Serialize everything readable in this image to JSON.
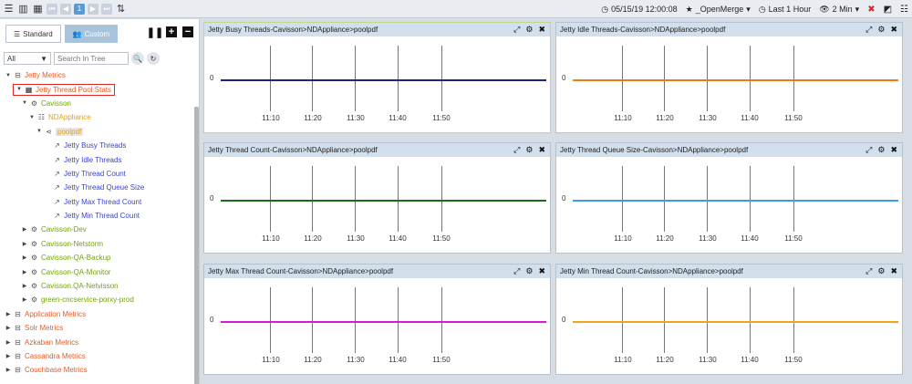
{
  "toolbar": {
    "timestamp": "05/15/19 12:00:08",
    "favorite": "_OpenMerge",
    "time_range": "Last 1 Hour",
    "refresh": "2 Min",
    "page_num": "1"
  },
  "sidebar": {
    "tabs": [
      {
        "label": "Standard"
      },
      {
        "label": "Custom"
      }
    ],
    "filter_value": "All",
    "search_placeholder": "Search In Tree",
    "tree": [
      {
        "label": "Jetty Metrics"
      },
      {
        "label": "Jetty Thread Pool Stats"
      },
      {
        "label": "Cavisson"
      },
      {
        "label": "NDAppliance"
      },
      {
        "label": "poolpdf"
      },
      {
        "label": "Jetty Busy Threads"
      },
      {
        "label": "Jetty Idle Threads"
      },
      {
        "label": "Jetty Thread Count"
      },
      {
        "label": "Jetty Thread Queue Size"
      },
      {
        "label": "Jetty Max Thread Count"
      },
      {
        "label": "Jetty Min Thread Count"
      },
      {
        "label": "Cavisson-Dev"
      },
      {
        "label": "Cavisson-Netstorm"
      },
      {
        "label": "Cavisson-QA-Backup"
      },
      {
        "label": "Cavisson-QA-Monitor"
      },
      {
        "label": "Cavisson.QA-Netvisson"
      },
      {
        "label": "green-cncservice-porxy-prod"
      },
      {
        "label": "Application Metrics"
      },
      {
        "label": "Solr Metrics"
      },
      {
        "label": "Azkaban Metrics"
      },
      {
        "label": "Cassandra Metrics"
      },
      {
        "label": "Couchbase Metrics"
      }
    ]
  },
  "colors": {
    "metric_group": "#e25c2a",
    "tier": "#6fa800",
    "server": "#e3a21a",
    "graph_link": "#3a44c8"
  },
  "chart_data": [
    {
      "type": "line",
      "title": "Jetty Busy Threads-Cavisson>NDAppliance>poolpdf",
      "x": [
        "11:10",
        "11:20",
        "11:30",
        "11:40",
        "11:50"
      ],
      "series": [
        {
          "values": [
            0,
            0,
            0,
            0,
            0
          ],
          "color": "#1a237e"
        }
      ],
      "y_label": "0"
    },
    {
      "type": "line",
      "title": "Jetty Idle Threads-Cavisson>NDAppliance>poolpdf",
      "x": [
        "11:10",
        "11:20",
        "11:30",
        "11:40",
        "11:50"
      ],
      "series": [
        {
          "values": [
            0,
            0,
            0,
            0,
            0
          ],
          "color": "#ef7d1a"
        }
      ],
      "y_label": "0"
    },
    {
      "type": "line",
      "title": "Jetty Thread Count-Cavisson>NDAppliance>poolpdf",
      "x": [
        "11:10",
        "11:20",
        "11:30",
        "11:40",
        "11:50"
      ],
      "series": [
        {
          "values": [
            0,
            0,
            0,
            0,
            0
          ],
          "color": "#1b6b1b"
        }
      ],
      "y_label": "0"
    },
    {
      "type": "line",
      "title": "Jetty Thread Queue Size-Cavisson>NDAppliance>poolpdf",
      "x": [
        "11:10",
        "11:20",
        "11:30",
        "11:40",
        "11:50"
      ],
      "series": [
        {
          "values": [
            0,
            0,
            0,
            0,
            0
          ],
          "color": "#3b9de3"
        }
      ],
      "y_label": "0"
    },
    {
      "type": "line",
      "title": "Jetty Max Thread Count-Cavisson>NDAppliance>poolpdf",
      "x": [
        "11:10",
        "11:20",
        "11:30",
        "11:40",
        "11:50"
      ],
      "series": [
        {
          "values": [
            0,
            0,
            0,
            0,
            0
          ],
          "color": "#d31bd3"
        }
      ],
      "y_label": "0"
    },
    {
      "type": "line",
      "title": "Jetty Min Thread Count-Cavisson>NDAppliance>poolpdf",
      "x": [
        "11:10",
        "11:20",
        "11:30",
        "11:40",
        "11:50"
      ],
      "series": [
        {
          "values": [
            0,
            0,
            0,
            0,
            0
          ],
          "color": "#efa41a"
        }
      ],
      "y_label": "0"
    }
  ]
}
